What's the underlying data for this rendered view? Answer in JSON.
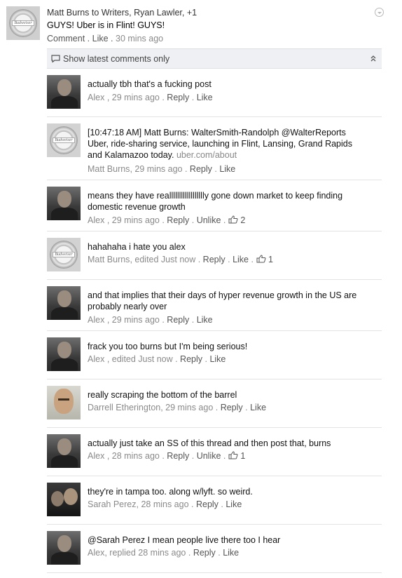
{
  "post": {
    "header": "Matt Burns to Writers, Ryan Lawler, +1",
    "text": "GUYS! Uber is in Flint! GUYS!",
    "comment_label": "Comment",
    "like_label": "Like",
    "time": "30 mins ago",
    "avatar_label": "Budweiser"
  },
  "show_bar": {
    "label": "Show latest comments only"
  },
  "comments": [
    {
      "author": "Alex",
      "text": "actually tbh that's a fucking post",
      "time": "29 mins ago",
      "reply": "Reply",
      "like": "Like"
    },
    {
      "author": "Matt Burns",
      "text": "[10:47:18 AM] Matt Burns: WalterSmith-Randolph @WalterReports Uber, ride-sharing service, launching in Flint, Lansing, Grand Rapids and Kalamazoo today.",
      "url": "uber.com/about",
      "time": "29 mins ago",
      "reply": "Reply",
      "like": "Like"
    },
    {
      "author": "Alex",
      "text": "means they have realllllllllllllllllly gone down market to keep finding domestic revenue growth",
      "time": "29 mins ago",
      "reply": "Reply",
      "like": "Unlike",
      "likes": "2"
    },
    {
      "author": "Matt Burns",
      "text": "hahahaha i hate you alex",
      "time": "edited Just now",
      "reply": "Reply",
      "like": "Like",
      "likes": "1"
    },
    {
      "author": "Alex",
      "text": "and that implies that their days of hyper revenue growth in the US are probably nearly over",
      "time": "29 mins ago",
      "reply": "Reply",
      "like": "Like"
    },
    {
      "author": "Alex",
      "text": "frack you too burns but I'm being serious!",
      "time": "edited Just now",
      "reply": "Reply",
      "like": "Like"
    },
    {
      "author": "Darrell Etherington",
      "text": "really scraping the bottom of the barrel",
      "time": "29 mins ago",
      "reply": "Reply",
      "like": "Like"
    },
    {
      "author": "Alex",
      "text": "actually just take an SS of this thread and then post that, burns",
      "time": "28 mins ago",
      "reply": "Reply",
      "like": "Unlike",
      "likes": "1"
    },
    {
      "author": "Sarah Perez",
      "text": "they're in tampa too. along w/lyft. so weird.",
      "time": "28 mins ago",
      "reply": "Reply",
      "like": "Like"
    },
    {
      "author": "Alex",
      "text": "@Sarah Perez I mean people live there too I hear",
      "time": "replied 28 mins ago",
      "reply": "Reply",
      "like": "Like"
    }
  ]
}
